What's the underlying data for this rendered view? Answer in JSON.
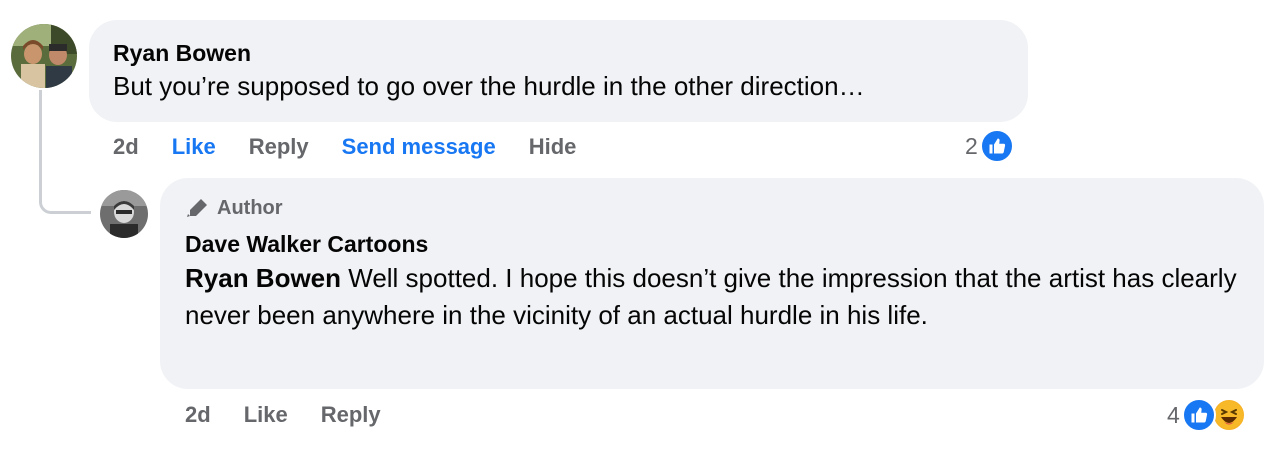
{
  "comment": {
    "author": "Ryan Bowen",
    "text": "But you’re supposed to go over the hurdle in the other direction…",
    "time": "2d",
    "like_label": "Like",
    "reply_label": "Reply",
    "send_message_label": "Send message",
    "hide_label": "Hide",
    "reaction_count": "2",
    "reactions": [
      "like-icon"
    ]
  },
  "reply": {
    "badge_label": "Author",
    "author": "Dave Walker Cartoons",
    "mention": "Ryan Bowen",
    "text": " Well spotted. I hope this doesn’t give the impression that the artist has clearly never been anywhere in the vicinity of an actual hurdle in his life.",
    "time": "2d",
    "like_label": "Like",
    "reply_label": "Reply",
    "reaction_count": "4",
    "reactions": [
      "like-icon",
      "haha-icon"
    ]
  },
  "colors": {
    "bubble": "#f0f2f5",
    "accent": "#1877f2",
    "muted": "#65676b"
  }
}
